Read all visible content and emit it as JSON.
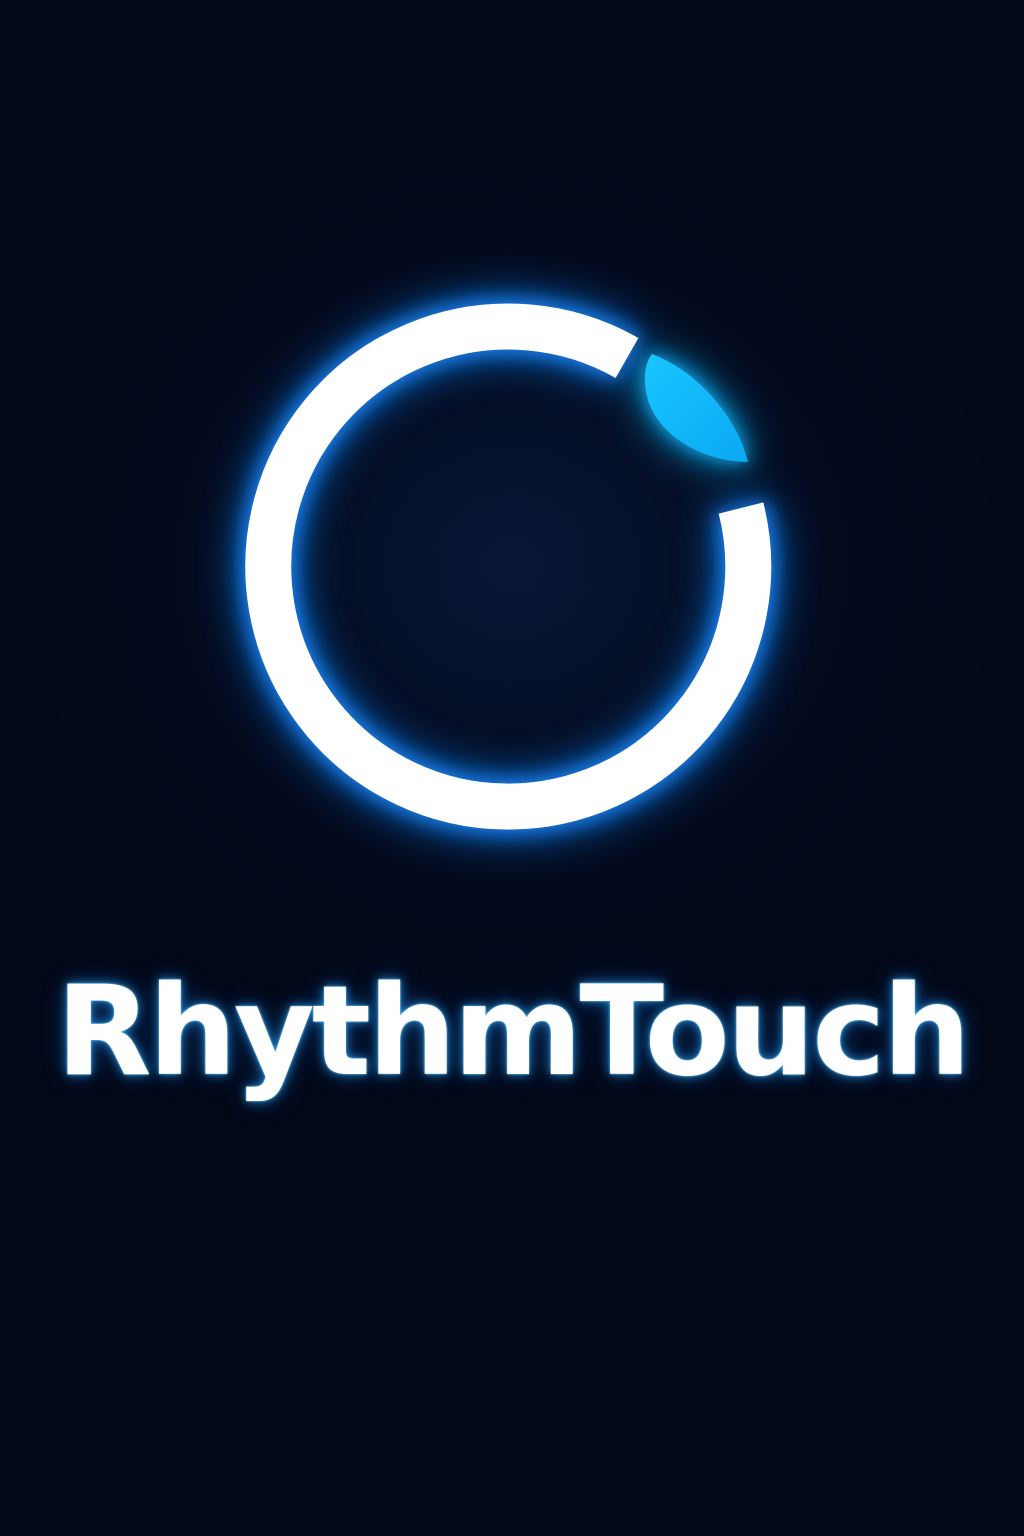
{
  "app": {
    "name": "RhythmTouch"
  },
  "logo": {
    "icon": "circular-ring-with-teardrop-icon"
  },
  "colors": {
    "background": "#03081a",
    "ring": "#ffffff",
    "accent": "#12b8ff",
    "glow": "#1e7fff"
  }
}
